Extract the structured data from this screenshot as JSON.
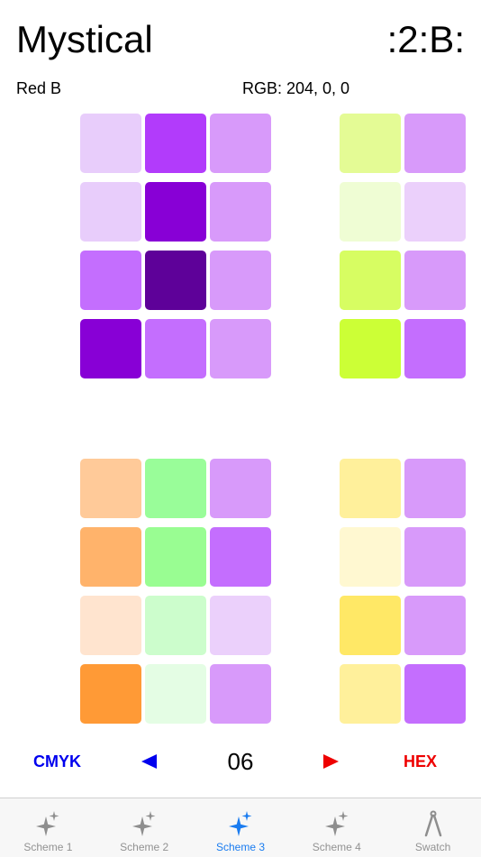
{
  "header": {
    "title": "Mystical",
    "code": ":2:B:"
  },
  "info": {
    "color_name": "Red B",
    "rgb": "RGB: 204, 0, 0"
  },
  "palette": {
    "top_left": [
      "#e8cdfb",
      "#b23bfb",
      "#d89afa",
      "#e8cdfb",
      "#8800d6",
      "#d89afa",
      "#c46efe",
      "#5e0199",
      "#d89afa",
      "#8800d6",
      "#c46efe",
      "#d89afa"
    ],
    "top_right": [
      "#e4fb95",
      "#d89afa",
      "#effdd4",
      "#ebd0fb",
      "#d7fd62",
      "#d89afa",
      "#ccff36",
      "#c46efe"
    ],
    "bottom_left": [
      "#ffca99",
      "#99fd99",
      "#d89afa",
      "#ffb36b",
      "#99fd92",
      "#c46efe",
      "#ffe4cf",
      "#ccfdcc",
      "#ebd0fb",
      "#ff9a36",
      "#e4fde4",
      "#d89afa"
    ],
    "bottom_right": [
      "#fff09b",
      "#d89afa",
      "#fff8d1",
      "#d89afa",
      "#ffe866",
      "#d89afa",
      "#fff09b",
      "#c46efe"
    ]
  },
  "nav": {
    "cmyk_label": "CMYK",
    "page_number": "06",
    "hex_label": "HEX",
    "left_arrow_color": "#0000ee",
    "right_arrow_color": "#ee0000"
  },
  "tabbar": {
    "active_color": "#1a7cf0",
    "inactive_color": "#929292",
    "tabs": [
      {
        "label": "Scheme 1",
        "icon": "sparkles-icon"
      },
      {
        "label": "Scheme 2",
        "icon": "sparkles-icon"
      },
      {
        "label": "Scheme 3",
        "icon": "sparkles-icon"
      },
      {
        "label": "Scheme 4",
        "icon": "sparkles-icon"
      },
      {
        "label": "Swatch",
        "icon": "compass-icon"
      }
    ]
  }
}
